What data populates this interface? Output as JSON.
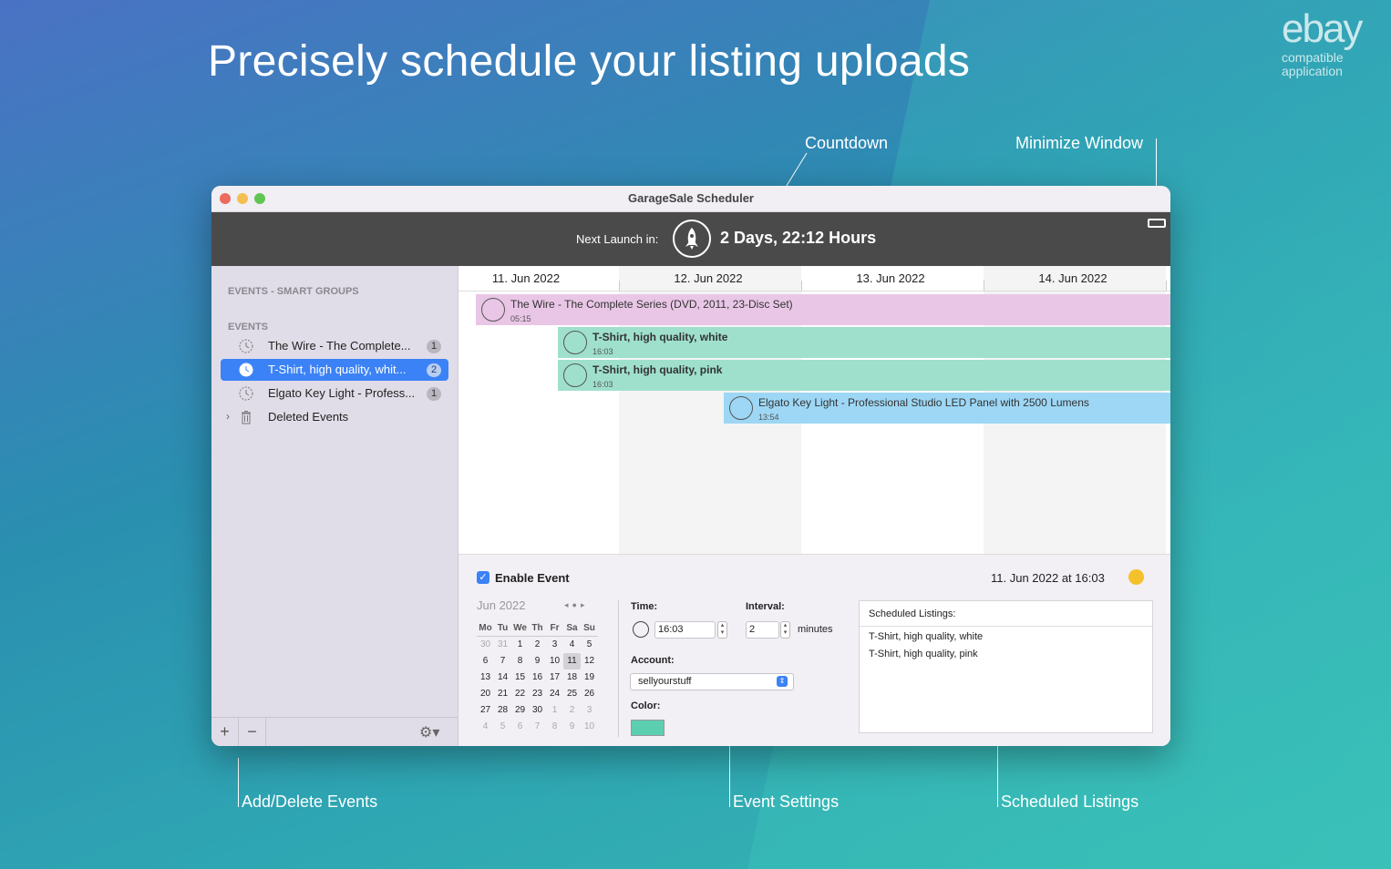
{
  "headline": "Precisely schedule your listing uploads",
  "brand": {
    "logo": "ebay",
    "line1": "compatible",
    "line2": "application"
  },
  "callouts": {
    "countdown": "Countdown",
    "minimize": "Minimize Window",
    "add_delete": "Add/Delete Events",
    "event_settings": "Event Settings",
    "scheduled_listings": "Scheduled Listings"
  },
  "window": {
    "title": "GarageSale Scheduler",
    "next_launch_label": "Next Launch in:",
    "next_launch_value": "2 Days, 22:12 Hours"
  },
  "sidebar": {
    "smart_groups_header": "EVENTS - SMART GROUPS",
    "events_header": "EVENTS",
    "items": [
      {
        "label": "The Wire - The Complete...",
        "badge": "1",
        "icon": "clock-icon"
      },
      {
        "label": "T-Shirt, high quality, whit...",
        "badge": "2",
        "icon": "clock-icon",
        "selected": true
      },
      {
        "label": "Elgato Key Light - Profess...",
        "badge": "1",
        "icon": "clock-icon"
      },
      {
        "label": "Deleted Events",
        "icon": "trash-icon"
      }
    ],
    "footer": {
      "add": "+",
      "remove": "−"
    }
  },
  "timeline": {
    "days": [
      "11. Jun 2022",
      "12. Jun 2022",
      "13. Jun 2022",
      "14. Jun 2022"
    ],
    "events": [
      {
        "title": "The Wire - The Complete Series (DVD, 2011, 23-Disc Set)",
        "time": "05:15",
        "color": "#e9c6e6",
        "bold": false
      },
      {
        "title": "T-Shirt, high quality, white",
        "time": "16:03",
        "color": "#9fe0cc",
        "bold": true
      },
      {
        "title": "T-Shirt, high quality, pink",
        "time": "16:03",
        "color": "#9fe0cc",
        "bold": true
      },
      {
        "title": "Elgato Key Light - Professional Studio LED Panel with 2500 Lumens",
        "time": "13:54",
        "color": "#9dd7f5",
        "bold": false
      }
    ]
  },
  "settings": {
    "enable_label": "Enable Event",
    "enabled": true,
    "date_label": "11. Jun 2022 at 16:03",
    "calendar": {
      "month": "Jun 2022",
      "weekdays": [
        "Mo",
        "Tu",
        "We",
        "Th",
        "Fr",
        "Sa",
        "Su"
      ],
      "weeks": [
        [
          "30",
          "31",
          "1",
          "2",
          "3",
          "4",
          "5"
        ],
        [
          "6",
          "7",
          "8",
          "9",
          "10",
          "11",
          "12"
        ],
        [
          "13",
          "14",
          "15",
          "16",
          "17",
          "18",
          "19"
        ],
        [
          "20",
          "21",
          "22",
          "23",
          "24",
          "25",
          "26"
        ],
        [
          "27",
          "28",
          "29",
          "30",
          "1",
          "2",
          "3"
        ],
        [
          "4",
          "5",
          "6",
          "7",
          "8",
          "9",
          "10"
        ]
      ],
      "selected": "11"
    },
    "time_label": "Time:",
    "time_value": "16:03",
    "interval_label": "Interval:",
    "interval_value": "2",
    "interval_unit": "minutes",
    "account_label": "Account:",
    "account_value": "sellyourstuff",
    "color_label": "Color:",
    "color_value": "#5ccfb0"
  },
  "listings": {
    "header": "Scheduled Listings:",
    "items": [
      "T-Shirt, high quality, white",
      "T-Shirt, high quality, pink"
    ]
  }
}
